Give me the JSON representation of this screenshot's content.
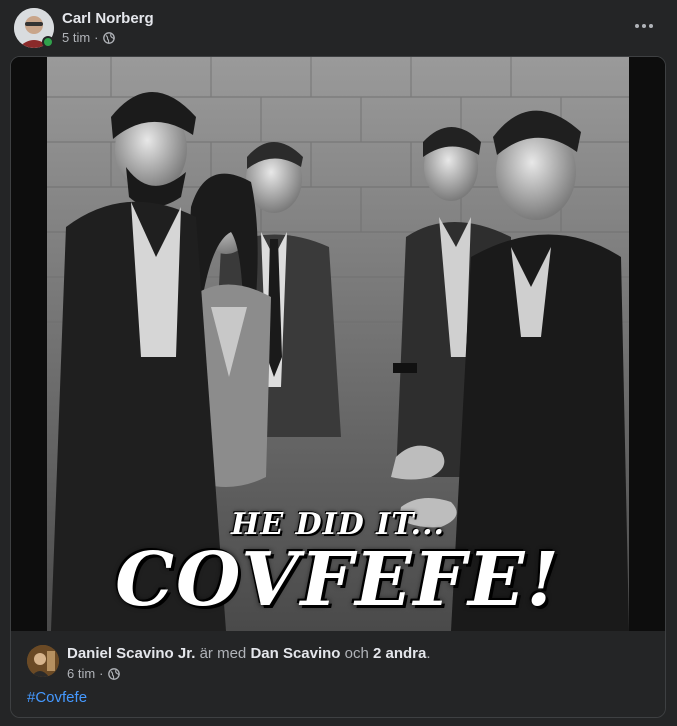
{
  "post": {
    "author": "Carl Norberg",
    "time": "5 tim",
    "separator": "·",
    "audience_icon": "globe-icon",
    "more_icon": "more-options-icon"
  },
  "shared": {
    "image_caption_small": "HE DID IT...",
    "image_caption_big": "COVFEFE!",
    "author": "Daniel Scavino Jr.",
    "with_text": "är med",
    "tagged": "Dan Scavino",
    "and_text": "och",
    "others": "2 andra",
    "period": ".",
    "time": "6 tim",
    "separator": "·",
    "audience_icon": "globe-icon",
    "hashtag": "#Covfefe"
  },
  "colors": {
    "background": "#242526",
    "online": "#31a24c",
    "link": "#4599ff"
  }
}
